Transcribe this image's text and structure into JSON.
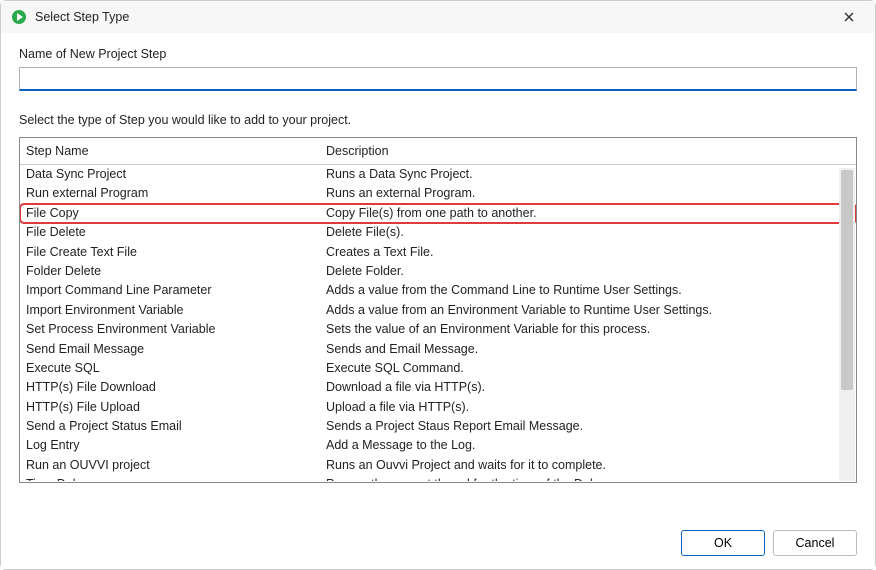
{
  "window": {
    "title": "Select Step Type"
  },
  "labels": {
    "name_field": "Name of New Project Step",
    "instruction": "Select the type of Step you would like to add to your project."
  },
  "input": {
    "name_value": ""
  },
  "columns": {
    "name": "Step Name",
    "desc": "Description"
  },
  "steps": [
    {
      "name": "Data Sync Project",
      "desc": "Runs a Data Sync Project.",
      "hl": false
    },
    {
      "name": "Run external Program",
      "desc": "Runs an external Program.",
      "hl": false
    },
    {
      "name": "File Copy",
      "desc": "Copy File(s) from one path to another.",
      "hl": true
    },
    {
      "name": "File Delete",
      "desc": "Delete File(s).",
      "hl": false
    },
    {
      "name": "File Create Text File",
      "desc": "Creates a Text File.",
      "hl": false
    },
    {
      "name": "Folder Delete",
      "desc": "Delete Folder.",
      "hl": false
    },
    {
      "name": "Import Command Line Parameter",
      "desc": "Adds a value from the Command Line to Runtime User Settings.",
      "hl": false
    },
    {
      "name": "Import Environment Variable",
      "desc": "Adds a value from an Environment Variable to Runtime User Settings.",
      "hl": false
    },
    {
      "name": "Set Process Environment Variable",
      "desc": "Sets the value of an Environment Variable for this process.",
      "hl": false
    },
    {
      "name": "Send Email Message",
      "desc": "Sends and Email Message.",
      "hl": false
    },
    {
      "name": "Execute SQL",
      "desc": "Execute SQL Command.",
      "hl": false
    },
    {
      "name": "HTTP(s) File Download",
      "desc": "Download a file via HTTP(s).",
      "hl": false
    },
    {
      "name": "HTTP(s) File Upload",
      "desc": "Upload a file via HTTP(s).",
      "hl": false
    },
    {
      "name": "Send a Project Status Email",
      "desc": "Sends a Project Staus Report Email Message.",
      "hl": false
    },
    {
      "name": "Log Entry",
      "desc": "Add a Message to the Log.",
      "hl": false
    },
    {
      "name": "Run an OUVVI project",
      "desc": "Runs an Ouvvi Project and waits for it to complete.",
      "hl": false
    },
    {
      "name": "Time Delay",
      "desc": "Pauses the current thread for the time of the Delay.",
      "hl": false
    }
  ],
  "buttons": {
    "ok": "OK",
    "cancel": "Cancel"
  }
}
